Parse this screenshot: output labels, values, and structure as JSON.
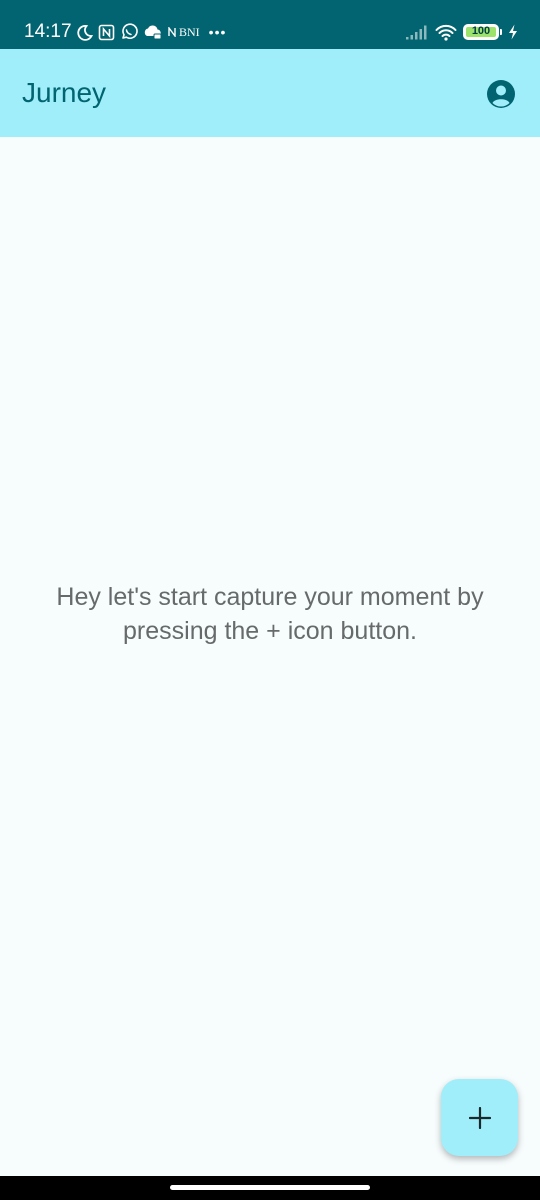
{
  "status_bar": {
    "time": "14:17",
    "carrier_label": "BNI",
    "more_indicator": "•••",
    "battery_level": "100",
    "left_icons": [
      "moon-icon",
      "nfc-icon",
      "whatsapp-icon",
      "cloud-games-icon",
      "carrier-icon"
    ],
    "right_icons": [
      "signal-icon",
      "wifi-icon",
      "battery-icon",
      "charging-icon"
    ]
  },
  "app_bar": {
    "title": "Jurney",
    "account_icon": "account-circle-icon"
  },
  "main": {
    "empty_message": "Hey let's start capture your moment by pressing the + icon button."
  },
  "fab": {
    "icon": "plus-icon"
  },
  "colors": {
    "status_bar": "#016470",
    "app_bar": "#9feefa",
    "accent": "#016470",
    "background": "#f7fcfd",
    "message_text": "#666a6b"
  }
}
